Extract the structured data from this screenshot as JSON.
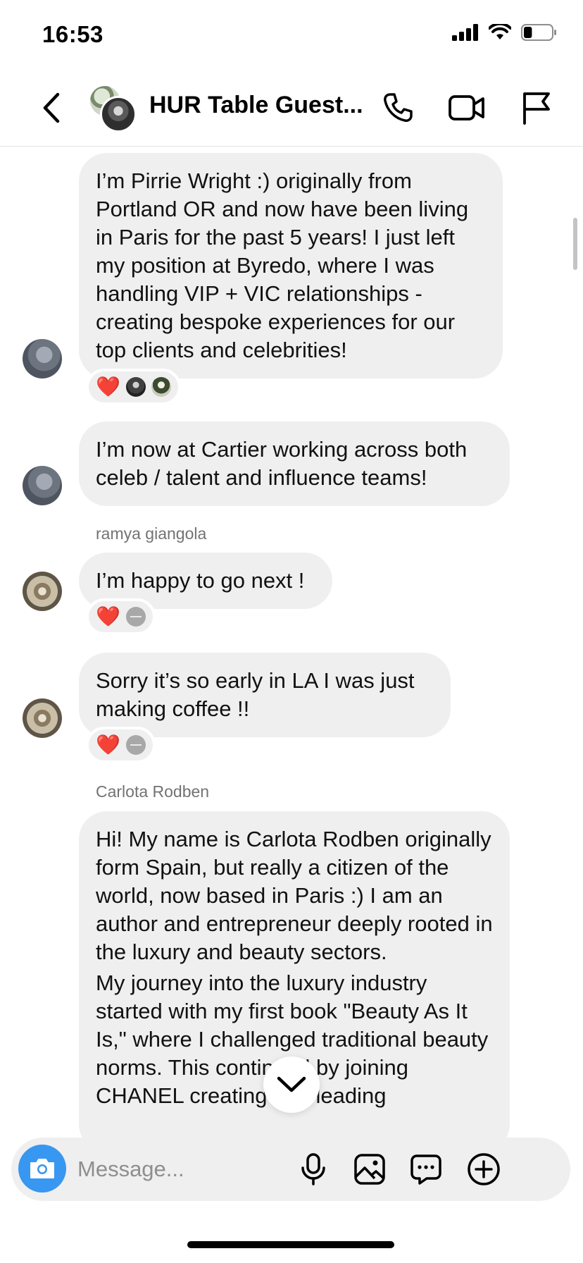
{
  "status_bar": {
    "time": "16:53",
    "battery_percent": 30
  },
  "header": {
    "title": "HUR Table Guest...",
    "back_icon": "chevron-left-icon",
    "call_icon": "phone-icon",
    "video_icon": "video-camera-icon",
    "report_icon": "flag-icon"
  },
  "messages": [
    {
      "paragraphs": [
        "I’m Pirrie Wright :) originally from Portland OR and now have been living in Paris for the past 5 years! I just left my position at Byredo, where I was handling VIP + VIC relationships - creating bespoke experiences for our top clients and celebrities!"
      ],
      "reactions": [
        "❤️"
      ]
    },
    {
      "paragraphs": [
        "I’m now at Cartier working across both celeb / talent and influence teams!"
      ]
    },
    {
      "sender": "ramya giangola",
      "paragraphs": [
        "I’m happy to go next !"
      ],
      "reactions": [
        "❤️"
      ]
    },
    {
      "paragraphs": [
        "Sorry it’s so early in LA I was just making coffee !!"
      ],
      "reactions": [
        "❤️"
      ]
    },
    {
      "sender": "Carlota Rodben",
      "paragraphs": [
        "Hi! My name is Carlota Rodben originally form Spain, but really a citizen of the world, now based in Paris :) I am an author and entrepreneur deeply rooted in the luxury and beauty sectors.",
        "My journey into the luxury industry started with my first book \"Beauty As It Is,\" where I challenged traditional beauty norms. This continued by joining CHANEL creating and leading"
      ]
    }
  ],
  "composer": {
    "placeholder": "Message...",
    "camera_icon": "camera-icon",
    "mic_icon": "microphone-icon",
    "gallery_icon": "image-icon",
    "sticker_icon": "chat-bubble-icon",
    "more_icon": "plus-circle-icon"
  },
  "colors": {
    "accent": "#3897f0",
    "bubble": "#efefef",
    "heart": "#e0102c"
  }
}
